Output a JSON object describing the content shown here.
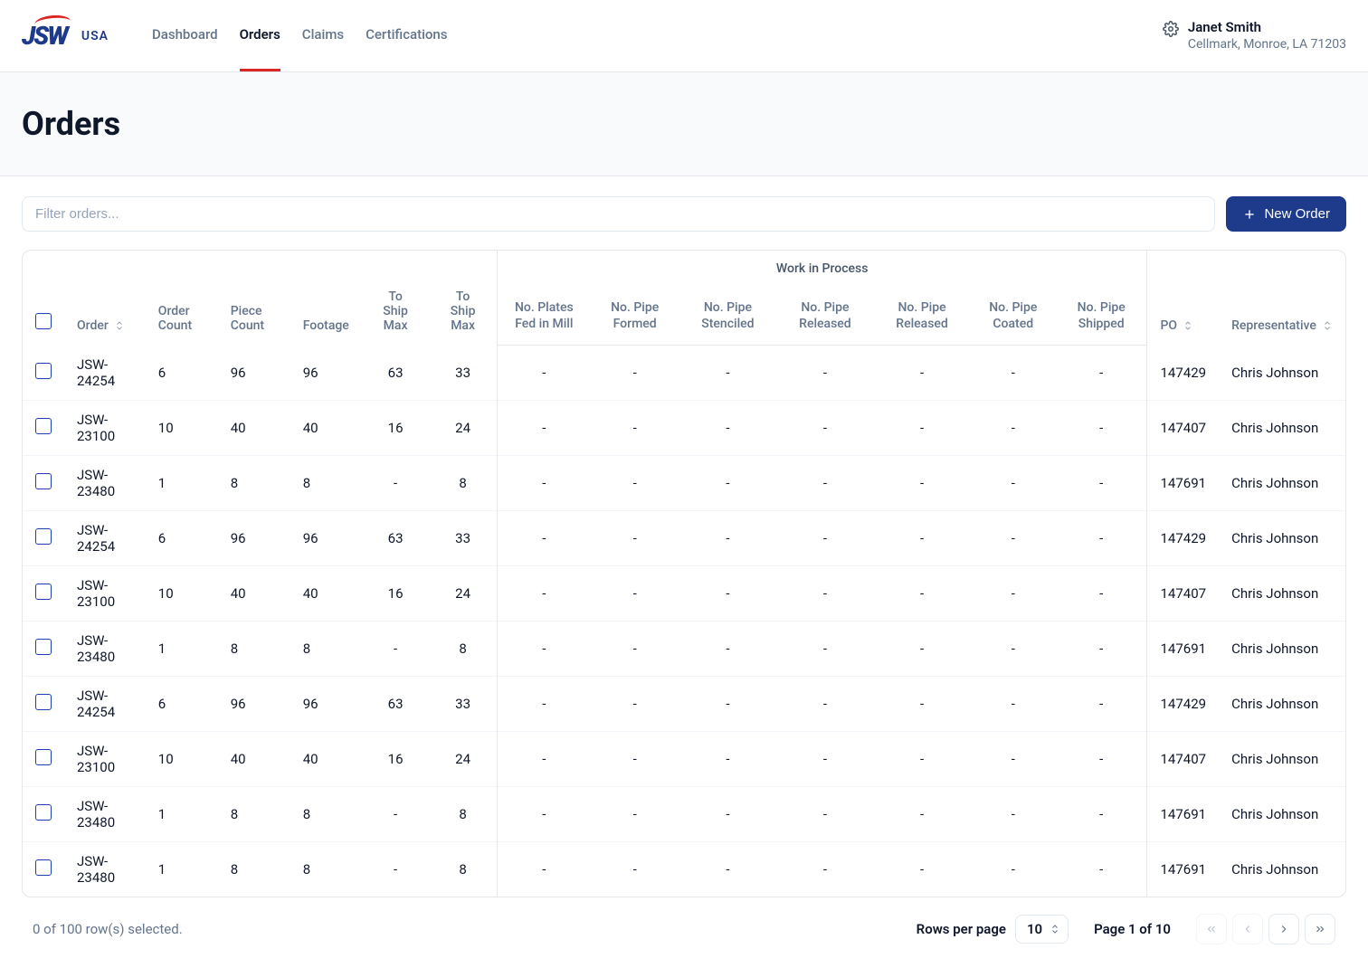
{
  "logo": {
    "brand": "JSW",
    "sub": "USA"
  },
  "nav": [
    {
      "label": "Dashboard",
      "active": false
    },
    {
      "label": "Orders",
      "active": true
    },
    {
      "label": "Claims",
      "active": false
    },
    {
      "label": "Certifications",
      "active": false
    }
  ],
  "user": {
    "name": "Janet Smith",
    "sub": "Cellmark, Monroe, LA 71203"
  },
  "page_title": "Orders",
  "filter": {
    "placeholder": "Filter orders..."
  },
  "new_order_label": "New Order",
  "group_header": "Work in Process",
  "columns": {
    "order": "Order",
    "order_count": "Order Count",
    "piece_count": "Piece Count",
    "footage": "Footage",
    "to_ship_max1": "To Ship Max",
    "to_ship_max2": "To Ship Max",
    "plates_fed": "No. Plates Fed in Mill",
    "pipe_formed": "No. Pipe Formed",
    "pipe_stenciled": "No. Pipe Stenciled",
    "pipe_released1": "No. Pipe Released",
    "pipe_released2": "No. Pipe Released",
    "pipe_coated": "No. Pipe Coated",
    "pipe_shipped": "No. Pipe Shipped",
    "po": "PO",
    "representative": "Representative"
  },
  "rows": [
    {
      "order": "JSW-24254",
      "order_count": "6",
      "piece_count": "96",
      "footage": "96",
      "ship1": "63",
      "ship2": "33",
      "w1": "-",
      "w2": "-",
      "w3": "-",
      "w4": "-",
      "w5": "-",
      "w6": "-",
      "w7": "-",
      "po": "147429",
      "rep": "Chris Johnson"
    },
    {
      "order": "JSW-23100",
      "order_count": "10",
      "piece_count": "40",
      "footage": "40",
      "ship1": "16",
      "ship2": "24",
      "w1": "-",
      "w2": "-",
      "w3": "-",
      "w4": "-",
      "w5": "-",
      "w6": "-",
      "w7": "-",
      "po": "147407",
      "rep": "Chris Johnson"
    },
    {
      "order": "JSW-23480",
      "order_count": "1",
      "piece_count": "8",
      "footage": "8",
      "ship1": "-",
      "ship2": "8",
      "w1": "-",
      "w2": "-",
      "w3": "-",
      "w4": "-",
      "w5": "-",
      "w6": "-",
      "w7": "-",
      "po": "147691",
      "rep": "Chris Johnson"
    },
    {
      "order": "JSW-24254",
      "order_count": "6",
      "piece_count": "96",
      "footage": "96",
      "ship1": "63",
      "ship2": "33",
      "w1": "-",
      "w2": "-",
      "w3": "-",
      "w4": "-",
      "w5": "-",
      "w6": "-",
      "w7": "-",
      "po": "147429",
      "rep": "Chris Johnson"
    },
    {
      "order": "JSW-23100",
      "order_count": "10",
      "piece_count": "40",
      "footage": "40",
      "ship1": "16",
      "ship2": "24",
      "w1": "-",
      "w2": "-",
      "w3": "-",
      "w4": "-",
      "w5": "-",
      "w6": "-",
      "w7": "-",
      "po": "147407",
      "rep": "Chris Johnson"
    },
    {
      "order": "JSW-23480",
      "order_count": "1",
      "piece_count": "8",
      "footage": "8",
      "ship1": "-",
      "ship2": "8",
      "w1": "-",
      "w2": "-",
      "w3": "-",
      "w4": "-",
      "w5": "-",
      "w6": "-",
      "w7": "-",
      "po": "147691",
      "rep": "Chris Johnson"
    },
    {
      "order": "JSW-24254",
      "order_count": "6",
      "piece_count": "96",
      "footage": "96",
      "ship1": "63",
      "ship2": "33",
      "w1": "-",
      "w2": "-",
      "w3": "-",
      "w4": "-",
      "w5": "-",
      "w6": "-",
      "w7": "-",
      "po": "147429",
      "rep": "Chris Johnson"
    },
    {
      "order": "JSW-23100",
      "order_count": "10",
      "piece_count": "40",
      "footage": "40",
      "ship1": "16",
      "ship2": "24",
      "w1": "-",
      "w2": "-",
      "w3": "-",
      "w4": "-",
      "w5": "-",
      "w6": "-",
      "w7": "-",
      "po": "147407",
      "rep": "Chris Johnson"
    },
    {
      "order": "JSW-23480",
      "order_count": "1",
      "piece_count": "8",
      "footage": "8",
      "ship1": "-",
      "ship2": "8",
      "w1": "-",
      "w2": "-",
      "w3": "-",
      "w4": "-",
      "w5": "-",
      "w6": "-",
      "w7": "-",
      "po": "147691",
      "rep": "Chris Johnson"
    },
    {
      "order": "JSW-23480",
      "order_count": "1",
      "piece_count": "8",
      "footage": "8",
      "ship1": "-",
      "ship2": "8",
      "w1": "-",
      "w2": "-",
      "w3": "-",
      "w4": "-",
      "w5": "-",
      "w6": "-",
      "w7": "-",
      "po": "147691",
      "rep": "Chris Johnson"
    }
  ],
  "footer": {
    "selected_text": "0 of 100 row(s) selected.",
    "rows_per_page_label": "Rows per page",
    "rows_per_page_value": "10",
    "page_label": "Page 1 of 10"
  }
}
